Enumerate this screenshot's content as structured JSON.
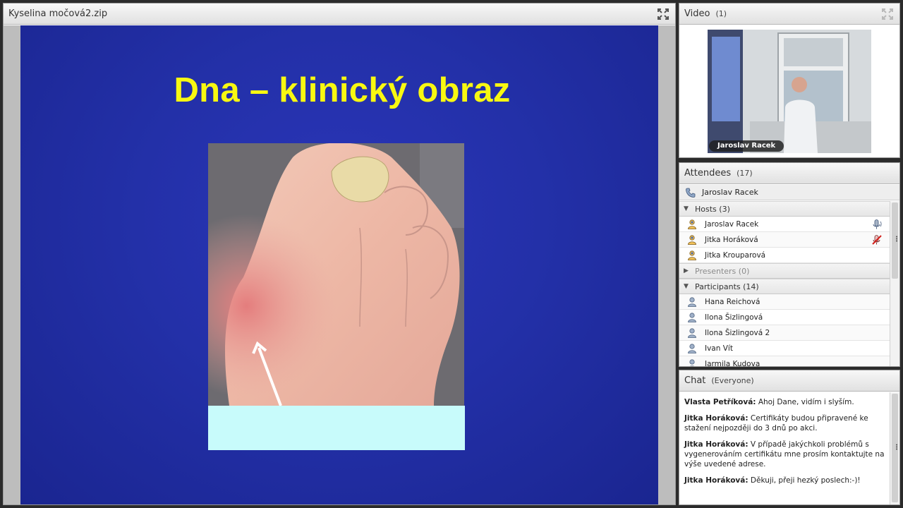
{
  "share": {
    "title": "Kyselina močová2.zip",
    "slide": {
      "title": "Dna – klinický obraz",
      "caption": ""
    }
  },
  "video": {
    "title": "Video",
    "count": "(1)",
    "presenter_tag": "Jaroslav Racek"
  },
  "attendees": {
    "title": "Attendees",
    "count": "(17)",
    "me": "Jaroslav Racek",
    "groups": [
      {
        "label": "Hosts (3)",
        "expanded": true,
        "items": [
          {
            "name": "Jaroslav Racek",
            "status": "mic-active"
          },
          {
            "name": "Jitka Horáková",
            "status": "mic-muted"
          },
          {
            "name": "Jitka Krouparová",
            "status": ""
          }
        ]
      },
      {
        "label": "Presenters (0)",
        "expanded": false,
        "items": []
      },
      {
        "label": "Participants (14)",
        "expanded": true,
        "items": [
          {
            "name": "Hana Reichová"
          },
          {
            "name": "Ilona Šizlingová"
          },
          {
            "name": "Ilona Šizlingová 2"
          },
          {
            "name": "Ivan Vít"
          },
          {
            "name": "Jarmila Kudova"
          }
        ]
      }
    ]
  },
  "chat": {
    "title": "Chat",
    "scope": "(Everyone)",
    "messages": [
      {
        "author": "Vlasta Petříková:",
        "text": " Ahoj Dane, vidím i slyším."
      },
      {
        "author": "Jitka Horáková:",
        "text": " Certifikáty budou připravené ke stažení nejpozději do 3 dnů po akci."
      },
      {
        "author": "Jitka Horáková:",
        "text": " V případě jakýchkoli problémů s vygenerováním certifikátu mne prosím kontaktujte na výše uvedené adrese."
      },
      {
        "author": "Jitka Horáková:",
        "text": " Děkuji, přeji hezký poslech:-)!"
      }
    ]
  },
  "colors": {
    "slide_bg": "#2330a8",
    "slide_title": "#f8f811",
    "caption_box": "#c8fbfb"
  },
  "icons": [
    "maximize-icon",
    "phone-icon",
    "host-user-icon",
    "participant-user-icon",
    "microphone-icon",
    "microphone-muted-icon"
  ]
}
